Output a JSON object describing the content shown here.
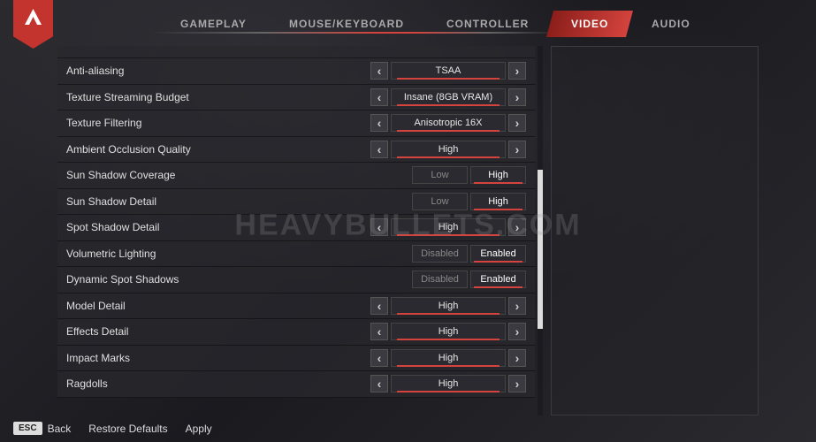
{
  "tabs": [
    "GAMEPLAY",
    "MOUSE/KEYBOARD",
    "CONTROLLER",
    "VIDEO",
    "AUDIO"
  ],
  "activeTab": "VIDEO",
  "settings": [
    {
      "label": "Anti-aliasing",
      "type": "selector",
      "value": "TSAA"
    },
    {
      "label": "Texture Streaming Budget",
      "type": "selector",
      "value": "Insane (8GB VRAM)"
    },
    {
      "label": "Texture Filtering",
      "type": "selector",
      "value": "Anisotropic 16X"
    },
    {
      "label": "Ambient Occlusion Quality",
      "type": "selector",
      "value": "High"
    },
    {
      "label": "Sun Shadow Coverage",
      "type": "toggle",
      "left": "Low",
      "right": "High",
      "active": "right"
    },
    {
      "label": "Sun Shadow Detail",
      "type": "toggle",
      "left": "Low",
      "right": "High",
      "active": "right"
    },
    {
      "label": "Spot Shadow Detail",
      "type": "selector",
      "value": "High"
    },
    {
      "label": "Volumetric Lighting",
      "type": "toggle",
      "left": "Disabled",
      "right": "Enabled",
      "active": "right"
    },
    {
      "label": "Dynamic Spot Shadows",
      "type": "toggle",
      "left": "Disabled",
      "right": "Enabled",
      "active": "right"
    },
    {
      "label": "Model Detail",
      "type": "selector",
      "value": "High"
    },
    {
      "label": "Effects Detail",
      "type": "selector",
      "value": "High"
    },
    {
      "label": "Impact Marks",
      "type": "selector",
      "value": "High"
    },
    {
      "label": "Ragdolls",
      "type": "selector",
      "value": "High"
    }
  ],
  "footer": {
    "esc": "ESC",
    "back": "Back",
    "restore": "Restore Defaults",
    "apply": "Apply"
  },
  "watermark": "HEAVYBULLETS.COM",
  "arrows": {
    "left": "‹",
    "right": "›"
  }
}
